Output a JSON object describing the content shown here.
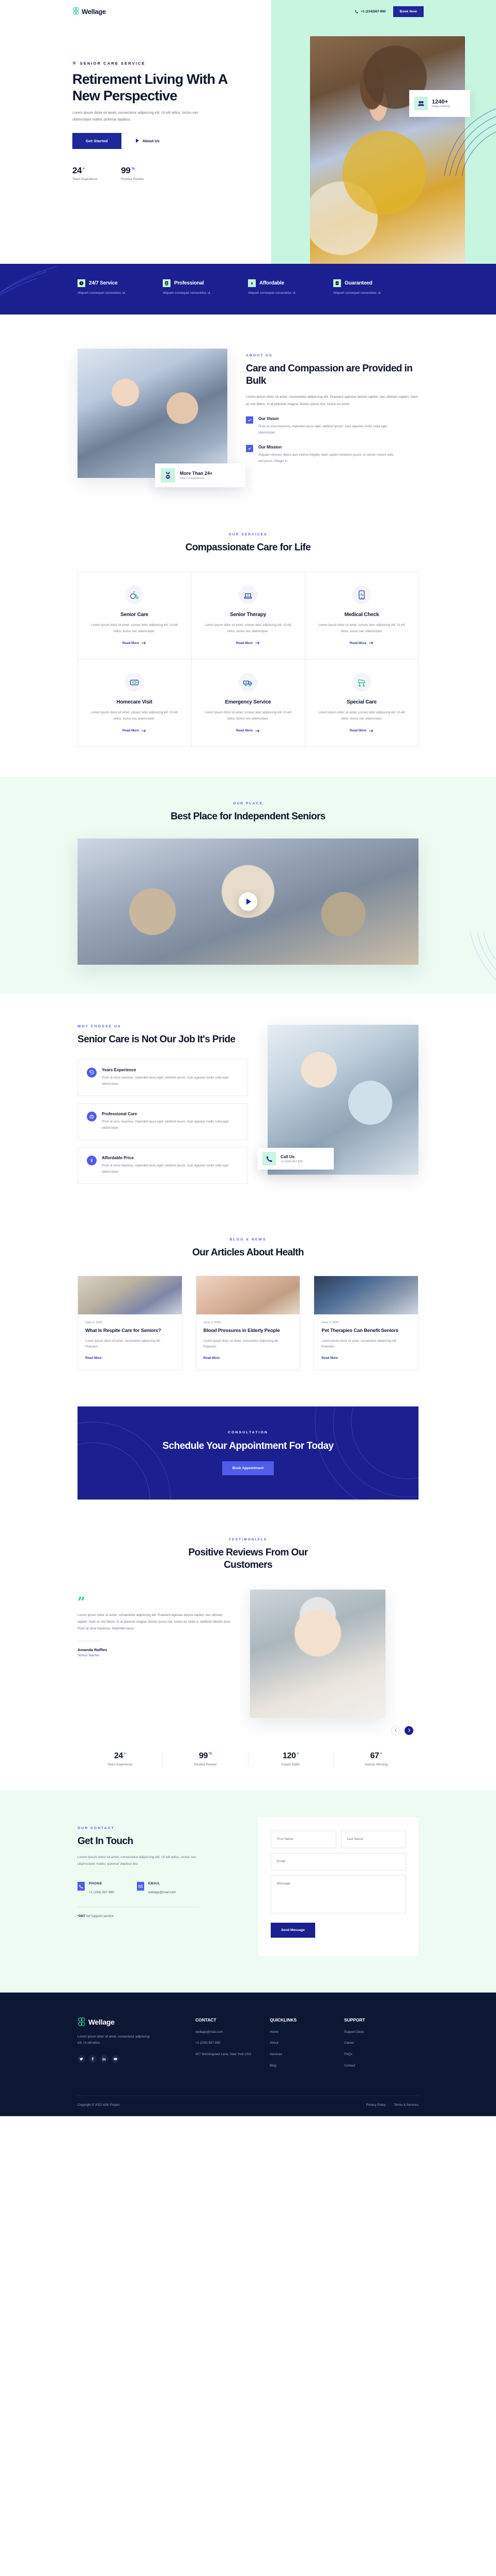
{
  "brand": {
    "name": "Wellage",
    "logo_icon": "wellage-logo-icon"
  },
  "header": {
    "phone": "+1 (234)567-890",
    "phone_icon": "phone-icon",
    "book_now_label": "Book Now"
  },
  "hero": {
    "eyebrow": "SENIOR CARE SERVICE",
    "eyebrow_icon": "asterisk-icon",
    "title": "Retirement Living With A New Perspective",
    "subtitle": "Lorem ipsum dolor sit amet, consectetur adipiscing elit. Ut elit tellus, luctus nec ullamcorper mattis, pulvinar dapibus.",
    "primary_button": "Get Started",
    "secondary_link": "About Us",
    "play_icon": "play-icon",
    "stat_card": {
      "icon": "happy-patients-icon",
      "number": "1240+",
      "label": "Happy Patients"
    },
    "stats": [
      {
        "value": "24",
        "suffix": "+",
        "label": "Years Experience"
      },
      {
        "value": "99",
        "suffix": "%",
        "label": "Positive Review"
      }
    ]
  },
  "features": [
    {
      "icon": "clock-icon",
      "title": "24/7 Service",
      "desc": "Aliquam consequat consectetur, ut."
    },
    {
      "icon": "user-badge-icon",
      "title": "Professional",
      "desc": "Aliquam consequat consectetur, ut."
    },
    {
      "icon": "dollar-icon",
      "title": "Affordable",
      "desc": "Aliquam consequat consectetur, ut."
    },
    {
      "icon": "checklist-icon",
      "title": "Guaranteed",
      "desc": "Aliquam consequat consectetur, ut."
    }
  ],
  "about": {
    "eyebrow": "ABOUT US",
    "title": "Care and Compassion are Provided in Bulk",
    "text": "Lorem ipsum dolor sit amet, consectetur adipiscing elit. Praesent egestas lacinia sapien, nec ultricies sapien. Nam ac nisi libero. In at placerat magna. Donec purus nisl, luctus eu tortor.",
    "badge": {
      "icon": "medal-icon",
      "title": "More Than 24+",
      "subtitle": "Years of Experience"
    },
    "points": [
      {
        "icon": "check-icon",
        "title": "Our Vision",
        "desc": "Proin at urna maximus, imperdiet lacus eget, eleifend ipsum. Duis egestas mollis nulla eget ullamcorper."
      },
      {
        "icon": "check-icon",
        "title": "Our Mission",
        "desc": "Aliquam ultricies, libero quis viverra fringilla, diam sapien hendrerit ipsum, in rutrum mauris ante sed purus. Integer in."
      }
    ]
  },
  "services": {
    "eyebrow": "OUR SERVICES",
    "title": "Compassionate Care for Life",
    "read_more": "Read More",
    "arrow_icon": "arrow-right-icon",
    "items": [
      {
        "icon": "wheelchair-icon",
        "title": "Senior Care",
        "desc": "Lorem ipsum dolor sit amet, consec tetur adipiscing elit. Ut elit tellus, luctus nec ullamcorper."
      },
      {
        "icon": "nurse-hat-icon",
        "title": "Senior Therapy",
        "desc": "Lorem ipsum dolor sit amet, consec tetur adipiscing elit. Ut elit tellus, luctus nec ullamcorper."
      },
      {
        "icon": "monitor-pulse-icon",
        "title": "Medical Check",
        "desc": "Lorem ipsum dolor sit amet, consec tetur adipiscing elit. Ut elit tellus, luctus nec ullamcorper."
      },
      {
        "icon": "first-aid-kit-icon",
        "title": "Homecare Visit",
        "desc": "Lorem ipsum dolor sit amet, consec tetur adipiscing elit. Ut elit tellus, luctus nec ullamcorper."
      },
      {
        "icon": "ambulance-icon",
        "title": "Emergency Service",
        "desc": "Lorem ipsum dolor sit amet, consec tetur adipiscing elit. Ut elit tellus, luctus nec ullamcorper."
      },
      {
        "icon": "hospital-bed-icon",
        "title": "Special Care",
        "desc": "Lorem ipsum dolor sit amet, consec tetur adipiscing elit. Ut elit tellus, luctus nec ullamcorper."
      }
    ]
  },
  "place": {
    "eyebrow": "OUR PLACE",
    "title": "Best Place for Independent Seniors",
    "play_icon": "play-icon"
  },
  "why": {
    "eyebrow": "WHY CHOOSE US",
    "title": "Senior Care is Not Our Job It's Pride",
    "items": [
      {
        "icon": "history-clock-icon",
        "title": "Years Experience",
        "desc": "Proin at urna maximus, imperdiet lacus eget, eleifend ipsum. Duis egestas mollis nulla eget ullamcorper."
      },
      {
        "icon": "medical-bag-icon",
        "title": "Professional Care",
        "desc": "Proin at urna maximus, imperdiet lacus eget, eleifend ipsum. Duis egestas mollis nulla eget ullamcorper."
      },
      {
        "icon": "dollar-circle-icon",
        "title": "Affordable Price",
        "desc": "Proin at urna maximus, imperdiet lacus eget, eleifend ipsum. Duis egestas mollis nulla eget ullamcorper."
      }
    ],
    "call_badge": {
      "icon": "phone-icon",
      "title": "Call Us",
      "subtitle": "+1 (234) 567 890"
    }
  },
  "blog": {
    "eyebrow": "BLOG & NEWS",
    "title": "Our Articles About Health",
    "read_more": "Read More",
    "posts": [
      {
        "date": "June 3, 2022",
        "title": "What Is Respite Care for Seniors?",
        "excerpt": "Lorem ipsum dolor sit amet, consectetur adipiscing elit. Praesent.."
      },
      {
        "date": "June 3, 2022",
        "title": "Blood Pressures in Elderly People",
        "excerpt": "Lorem ipsum dolor sit amet, consectetur adipiscing elit. Praesent.."
      },
      {
        "date": "June 3, 2022",
        "title": "Pet Therapies Can Benefit Seniors",
        "excerpt": "Lorem ipsum dolor sit amet, consectetur adipiscing elit. Praesent.."
      }
    ]
  },
  "cta": {
    "eyebrow": "CONSULTATION",
    "title": "Schedule Your Appointment For Today",
    "button": "Book Appointment"
  },
  "testimonials": {
    "eyebrow": "TESTIMONIALS",
    "title": "Positive Reviews From Our Customers",
    "quote_icon": "quote-icon",
    "text": "Lorem ipsum dolor sit amet, consectetur adipiscing elit. Praesent egestas lacinia sapien, nec ultricies sapien. Nam ac nisi libero. In at placerat magna. Donec purus nisl, luctus eu tortor a, eleifend lobortis arcu. Proin at urna maximus, imperdiet lacus.",
    "author": "Amanda Raffles",
    "role": "School Teacher",
    "prev_icon": "chevron-left-icon",
    "next_icon": "chevron-right-icon",
    "stats": [
      {
        "value": "24",
        "suffix": "+",
        "label": "Years Experience"
      },
      {
        "value": "99",
        "suffix": "%",
        "label": "Positive Review"
      },
      {
        "value": "120",
        "suffix": "+",
        "label": "Expert Staffs"
      },
      {
        "value": "67",
        "suffix": "+",
        "label": "Awards Winning"
      }
    ]
  },
  "contact": {
    "eyebrow": "OUR CONTACT",
    "title": "Get In Touch",
    "text": "Lorem ipsum dolor sit amet, consectetur adipiscing elit. Ut elit tellus, luctus nec ullamcorper mattis, pulvinar dapibus leo.",
    "phone_label": "PHONE",
    "phone_value": "+1 (234) 567 890",
    "phone_icon": "phone-icon",
    "email_label": "EMAIL",
    "email_value": "wellage@mail.com",
    "email_icon": "envelope-icon",
    "support_bold": "*24/7",
    "support_rest": " full support service",
    "form": {
      "first_name_placeholder": "First Name",
      "last_name_placeholder": "Last Name",
      "email_placeholder": "Email",
      "message_placeholder": "Message",
      "submit_label": "Send Message"
    }
  },
  "footer": {
    "desc": "Lorem ipsum dolor sit amet, consectetur adipiscing elit. Ut elit tellus.",
    "socials": [
      {
        "icon": "twitter-icon"
      },
      {
        "icon": "facebook-icon"
      },
      {
        "icon": "linkedin-icon"
      },
      {
        "icon": "youtube-icon"
      }
    ],
    "columns": [
      {
        "heading": "CONTACT",
        "items": [
          "wellage@mail.com",
          "+1 (234) 567 890",
          "457 Morningview Lane, New York USA"
        ]
      },
      {
        "heading": "QUICKLINKS",
        "items": [
          "Home",
          "About",
          "Services",
          "Blog"
        ]
      },
      {
        "heading": "SUPPORT",
        "items": [
          "Support Desk",
          "Career",
          "FAQs",
          "Contact"
        ]
      }
    ],
    "copyright": "Copyright © 2022 ASK Project",
    "legal": [
      "Privacy Policy",
      "Terms & Services"
    ]
  }
}
